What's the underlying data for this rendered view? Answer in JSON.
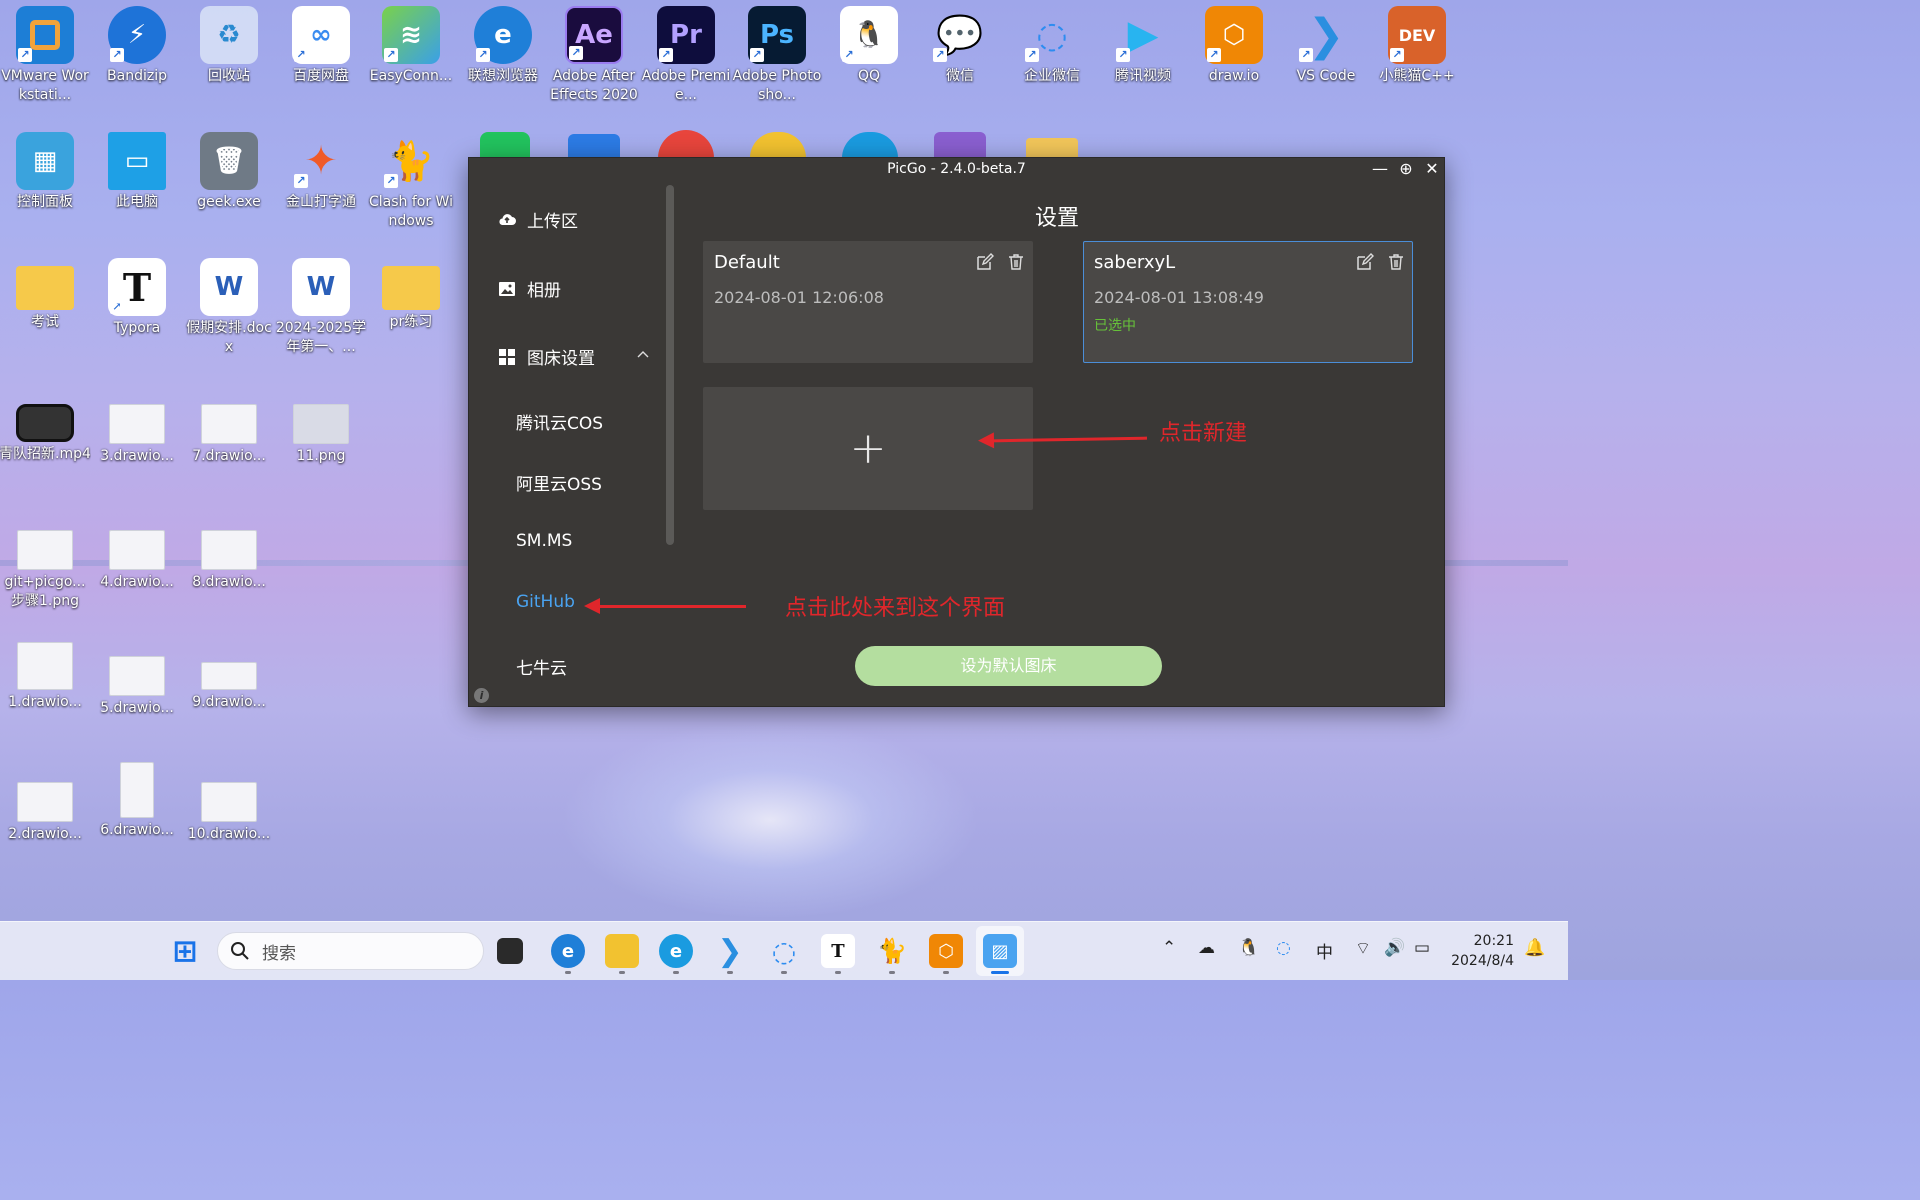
{
  "desktop": {
    "row1": [
      "VMware Workstati...",
      "Bandizip",
      "回收站",
      "百度网盘",
      "EasyConn...",
      "联想浏览器",
      "Adobe After Effects 2020",
      "Adobe Premie...",
      "Adobe Photosho...",
      "QQ",
      "微信",
      "企业微信",
      "腾讯视频",
      "draw.io",
      "VS Code",
      "小熊猫C++"
    ],
    "row2": [
      "控制面板",
      "此电脑",
      "geek.exe",
      "金山打字通",
      "Clash for Windows"
    ],
    "col_files": [
      "考试",
      "Typora",
      "假期安排.docx",
      "2024-2025学年第一、...",
      "pr练习",
      "青队招新.mp4",
      "3.drawio...",
      "7.drawio...",
      "11.png",
      "git+picgo...步骤1.png",
      "4.drawio...",
      "8.drawio...",
      "1.drawio...",
      "5.drawio...",
      "9.drawio...",
      "2.drawio...",
      "6.drawio...",
      "10.drawio..."
    ],
    "glyphs": {
      "ae": "Ae",
      "pr": "Pr",
      "ps": "Ps",
      "typora": "T",
      "word": "W",
      "dev": "DEV"
    }
  },
  "window": {
    "title": "PicGo - 2.4.0-beta.7",
    "controls": {
      "minimize": "—",
      "pin": "⊕",
      "close": "✕"
    }
  },
  "sidebar": {
    "upload": "上传区",
    "gallery": "相册",
    "picbed_settings": "图床设置",
    "sub_items": [
      "腾讯云COS",
      "阿里云OSS",
      "SM.MS",
      "GitHub",
      "七牛云"
    ],
    "info": "i"
  },
  "main": {
    "title": "设置",
    "configs": [
      {
        "name": "Default",
        "time": "2024-08-01 12:06:08",
        "state": ""
      },
      {
        "name": "saberxyL",
        "time": "2024-08-01 13:08:49",
        "state": "已选中"
      }
    ],
    "add_symbol": "+",
    "default_button": "设为默认图床"
  },
  "annotations": {
    "new_hint": "点击新建",
    "github_hint": "点击此处来到这个界面"
  },
  "taskbar": {
    "search_placeholder": "搜索",
    "ime": "中",
    "time": "20:21",
    "date": "2024/8/4",
    "typora_glyph": "T"
  }
}
